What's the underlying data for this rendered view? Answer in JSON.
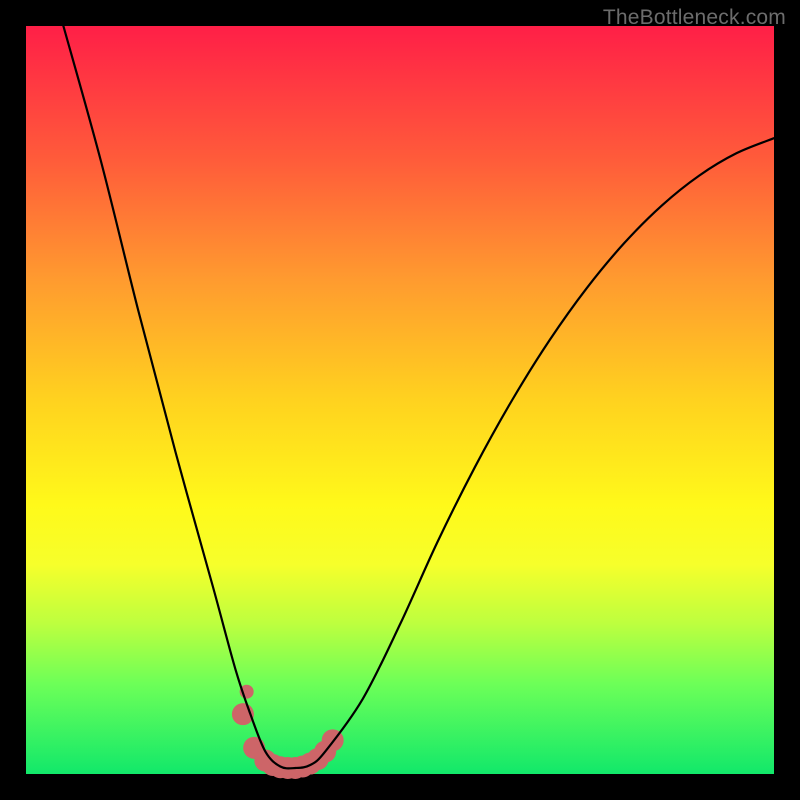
{
  "watermark": "TheBottleneck.com",
  "chart_data": {
    "type": "line",
    "title": "",
    "xlabel": "",
    "ylabel": "",
    "xlim": [
      0,
      100
    ],
    "ylim": [
      0,
      100
    ],
    "grid": false,
    "background": "red-yellow-green vertical gradient",
    "series": [
      {
        "name": "bottleneck-curve",
        "type": "line",
        "color": "#000000",
        "x": [
          5,
          10,
          15,
          20,
          25,
          28,
          30,
          32,
          34,
          36,
          38,
          40,
          45,
          50,
          55,
          60,
          65,
          70,
          75,
          80,
          85,
          90,
          95,
          100
        ],
        "y": [
          100,
          82,
          62,
          43,
          25,
          14,
          8,
          3,
          1,
          0.8,
          1.2,
          3,
          10,
          20,
          31,
          41,
          50,
          58,
          65,
          71,
          76,
          80,
          83,
          85
        ]
      },
      {
        "name": "highlight-dots",
        "type": "scatter",
        "color": "#CD6568",
        "x": [
          29.0,
          30.5,
          32.0,
          33.0,
          34.0,
          35.0,
          36.0,
          37.0,
          38.0,
          39.0,
          40.0,
          41.0,
          29.5
        ],
        "y": [
          8.0,
          3.5,
          1.8,
          1.2,
          0.9,
          0.8,
          0.8,
          1.0,
          1.4,
          2.0,
          3.0,
          4.5,
          11.0
        ]
      }
    ]
  }
}
